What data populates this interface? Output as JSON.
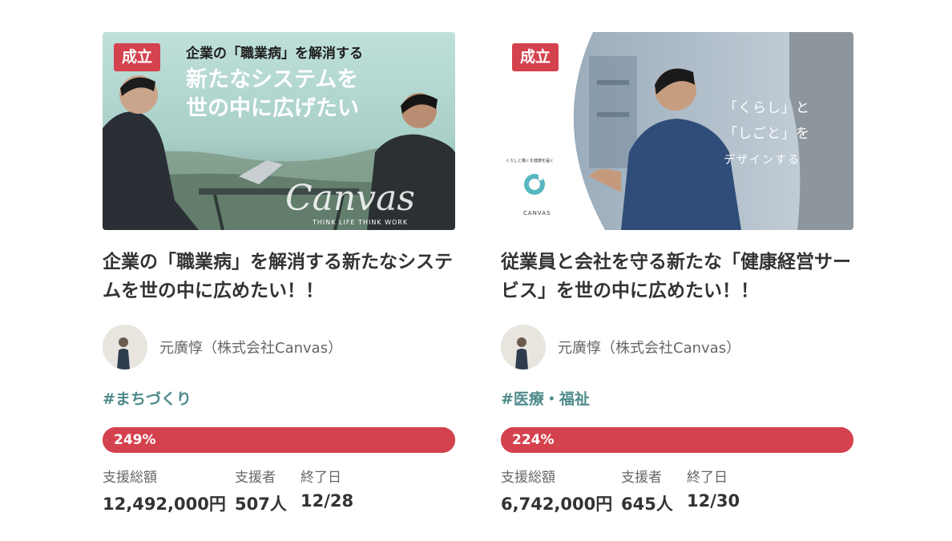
{
  "projects": [
    {
      "status_badge": "成立",
      "image_text": {
        "line1": "企業の「職業病」を解消する",
        "line2": "新たなシステムを",
        "line3": "世の中に広げたい",
        "script_logo": "Canvas",
        "tagline": "THINK LIFE   THINK WORK"
      },
      "title": "企業の「職業病」を解消する新たなシステムを世の中に広めたい！！",
      "owner": "元廣惇（株式会社Canvas）",
      "tag": "#まちづくり",
      "progress_label": "249%",
      "progress_percent": 249,
      "stats": [
        {
          "label": "支援総額",
          "value": "12,492,000円"
        },
        {
          "label": "支援者",
          "value": "507人"
        },
        {
          "label": "終了日",
          "value": "12/28"
        }
      ]
    },
    {
      "status_badge": "成立",
      "image_text": {
        "line1": "「くらし」と",
        "line2": "「しごと」を",
        "line3": "デザインする",
        "small_caption": "くらしと働くを健康を届く",
        "logo_text": "CANVAS"
      },
      "title": "従業員と会社を守る新たな「健康経営サービス」を世の中に広めたい！！",
      "owner": "元廣惇（株式会社Canvas）",
      "tag": "#医療・福祉",
      "progress_label": "224%",
      "progress_percent": 224,
      "stats": [
        {
          "label": "支援総額",
          "value": "6,742,000円"
        },
        {
          "label": "支援者",
          "value": "645人"
        },
        {
          "label": "終了日",
          "value": "12/30"
        }
      ]
    }
  ],
  "colors": {
    "accent_red": "#d4424e",
    "tag_teal": "#4f8a8b"
  }
}
